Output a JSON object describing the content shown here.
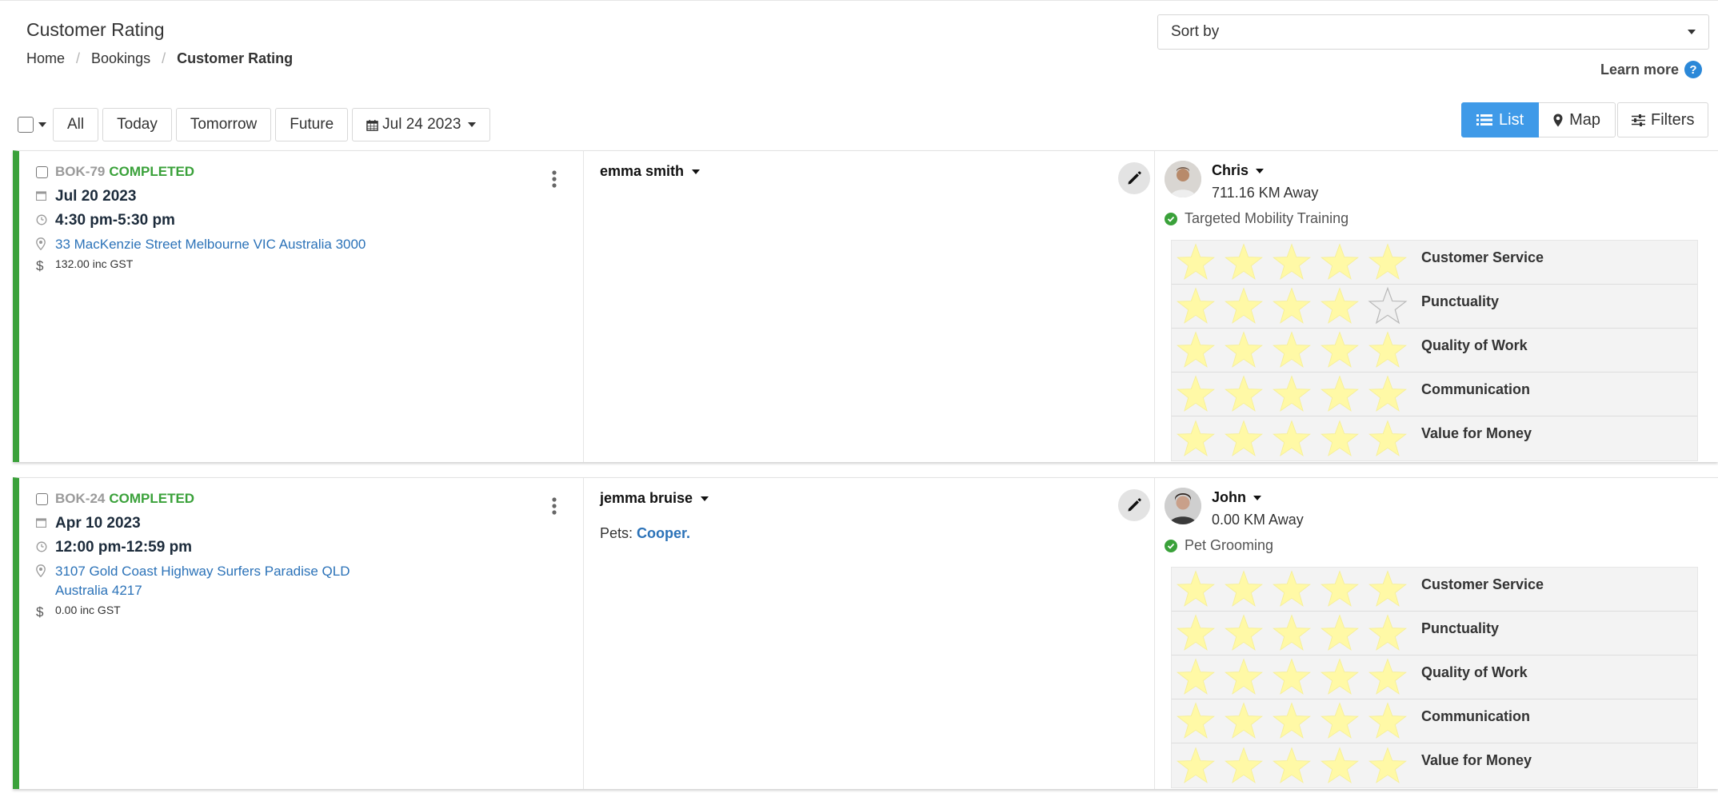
{
  "header": {
    "title": "Customer Rating",
    "breadcrumb": [
      "Home",
      "Bookings",
      "Customer Rating"
    ],
    "sort_placeholder": "Sort by",
    "learn_more": "Learn more",
    "help_glyph": "?"
  },
  "filters": {
    "buttons": [
      "All",
      "Today",
      "Tomorrow",
      "Future"
    ],
    "date": "Jul 24 2023"
  },
  "view": {
    "list_label": "List",
    "map_label": "Map",
    "filters_label": "Filters"
  },
  "colors": {
    "completed": "#3aa13a",
    "link": "#2b72b8",
    "active_view": "#3f9ae8",
    "star_filled": "#fff9a6",
    "star_empty": "#f0f0f0"
  },
  "icons": [
    "calendar-icon",
    "clock-icon",
    "map-marker-icon",
    "dollar-icon",
    "kebab-menu-icon",
    "pencil-icon",
    "list-icon",
    "map-pin-icon",
    "sliders-icon",
    "check-circle-icon",
    "star-icon",
    "help-icon"
  ],
  "rating_labels": [
    "Customer Service",
    "Punctuality",
    "Quality of Work",
    "Communication",
    "Value for Money"
  ],
  "bookings": [
    {
      "id": "BOK-79",
      "status": "COMPLETED",
      "date": "Jul 20 2023",
      "time": "4:30 pm-5:30 pm",
      "address_line1": "33 MacKenzie Street Melbourne VIC Australia 3000",
      "address_line2": "",
      "price": "132.00 inc GST",
      "customer": "emma smith",
      "pets_label": "",
      "pets_value": "",
      "provider": "Chris",
      "distance": "711.16 KM Away",
      "service": "Targeted Mobility Training",
      "ratings": [
        5,
        4,
        5,
        5,
        5
      ]
    },
    {
      "id": "BOK-24",
      "status": "COMPLETED",
      "date": "Apr 10 2023",
      "time": "12:00 pm-12:59 pm",
      "address_line1": "3107 Gold Coast Highway Surfers Paradise QLD",
      "address_line2": "Australia 4217",
      "price": "0.00 inc GST",
      "customer": "jemma bruise",
      "pets_label": "Pets: ",
      "pets_value": "Cooper.",
      "provider": "John",
      "distance": "0.00 KM Away",
      "service": "Pet Grooming",
      "ratings": [
        5,
        5,
        5,
        5,
        5
      ]
    }
  ]
}
